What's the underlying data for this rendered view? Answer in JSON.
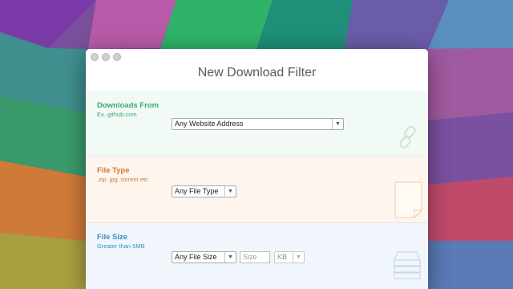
{
  "window": {
    "title": "New Download Filter"
  },
  "sections": {
    "downloads_from": {
      "title": "Downloads From",
      "subtitle": "Ex. github.com",
      "dropdown_value": "Any Website Address",
      "accent": "#3aa57a",
      "background": "#f2faf5",
      "icon": "link-icon"
    },
    "file_type": {
      "title": "File Type",
      "subtitle": ".zip .jpg .torrent etc",
      "dropdown_value": "Any File Type",
      "accent": "#d8782e",
      "background": "#fdf5ee",
      "icon": "document-icon"
    },
    "file_size": {
      "title": "File Size",
      "subtitle": "Greater than 5MB",
      "dropdown_value": "Any File Size",
      "size_placeholder": "Size",
      "unit_value": "KB",
      "accent": "#3a8fc0",
      "background": "#f0f6fb",
      "icon": "drive-icon"
    }
  }
}
